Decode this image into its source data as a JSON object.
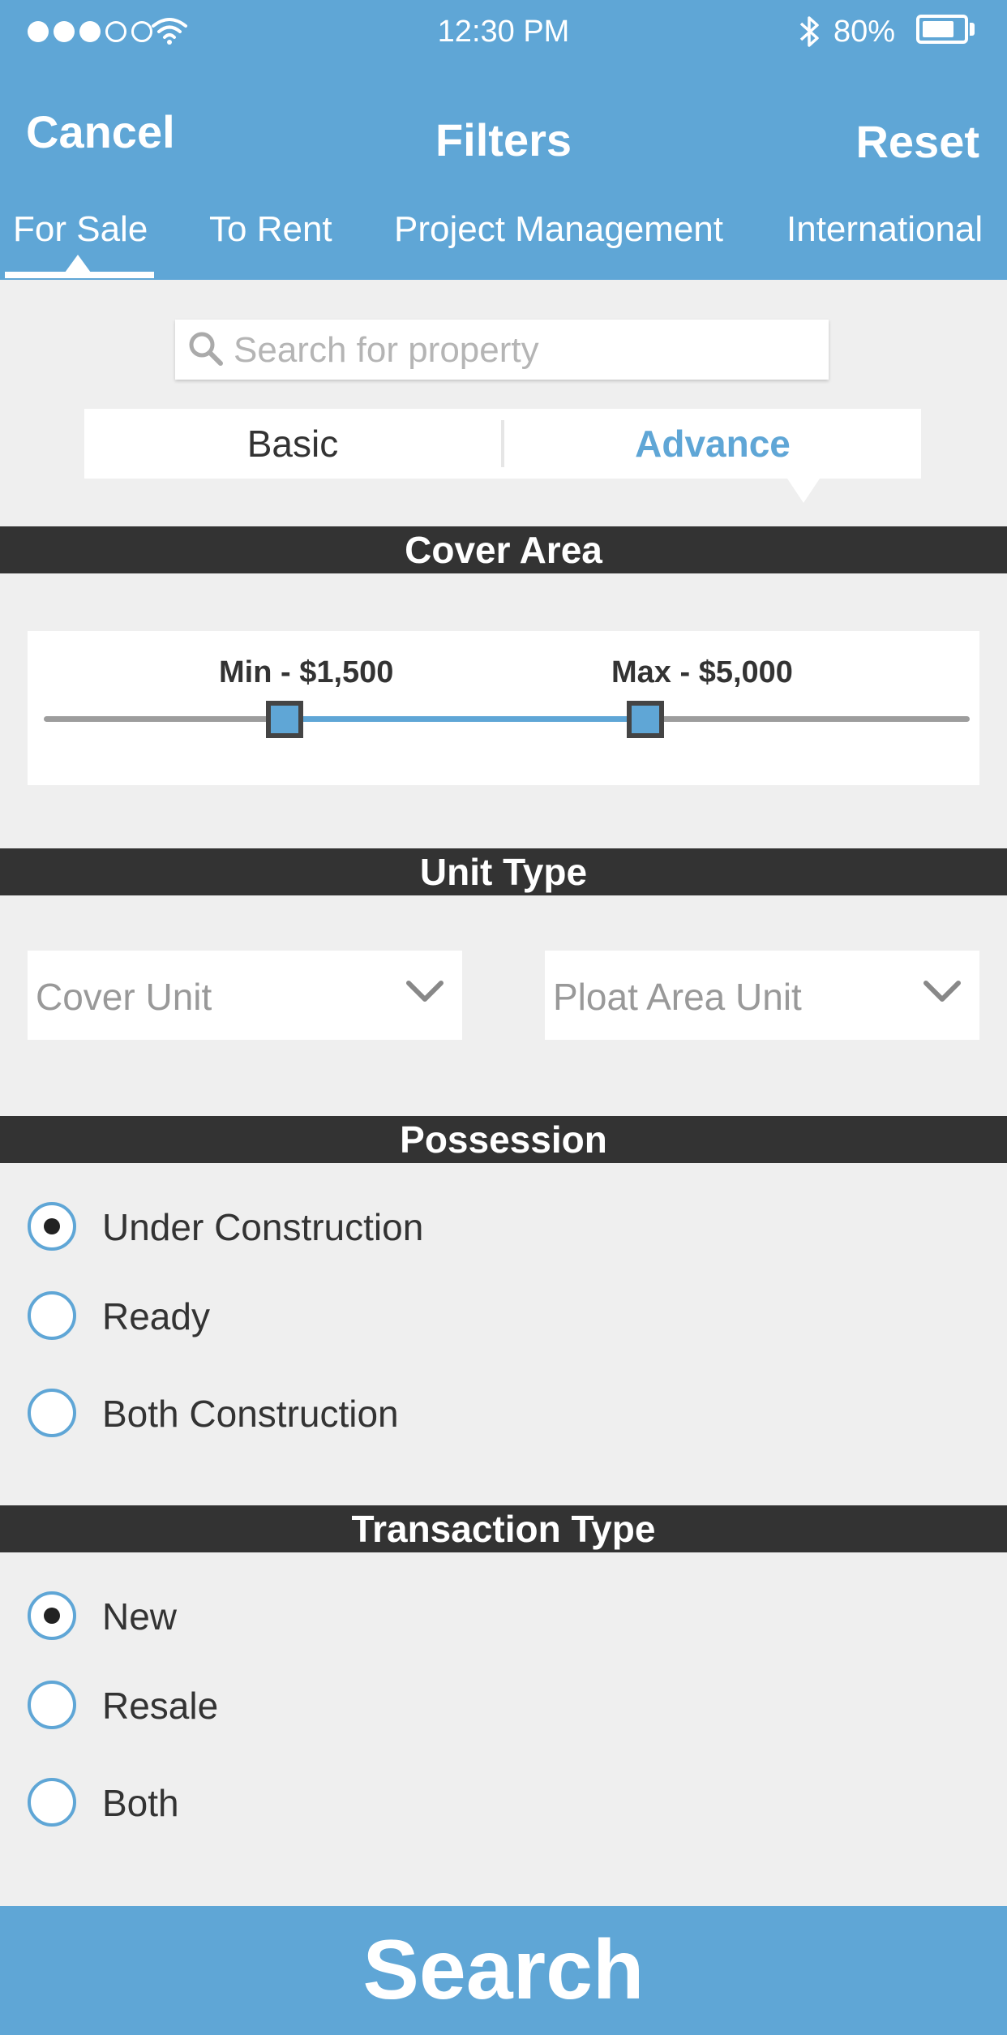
{
  "status_bar": {
    "time": "12:30 PM",
    "battery_percent": "80%",
    "battery_level": 0.8,
    "signal_bars_filled": 3,
    "signal_bars_total": 5,
    "icons": [
      "wifi-icon",
      "bluetooth-icon",
      "battery-icon"
    ]
  },
  "nav": {
    "cancel_label": "Cancel",
    "title": "Filters",
    "reset_label": "Reset"
  },
  "tabs": [
    {
      "label": "For Sale",
      "active": true
    },
    {
      "label": "To Rent",
      "active": false
    },
    {
      "label": "Project Management",
      "active": false
    },
    {
      "label": "International",
      "active": false
    }
  ],
  "search": {
    "placeholder": "Search for property",
    "value": ""
  },
  "mode": {
    "basic_label": "Basic",
    "advance_label": "Advance",
    "selected": "Advance"
  },
  "sections": {
    "cover_area": "Cover Area",
    "unit_type": "Unit Type",
    "possession": "Possession",
    "transaction_type": "Transaction Type"
  },
  "price_slider": {
    "min_label": "Min - $1,500",
    "max_label": "Max - $5,000",
    "min_position": 0.26,
    "max_position": 0.65
  },
  "unit_type": {
    "cover_unit": "Cover Unit",
    "ploat_area_unit": "Ploat Area Unit"
  },
  "possession": {
    "options": [
      "Under Construction",
      "Ready",
      "Both Construction"
    ],
    "selected": "Under Construction"
  },
  "transaction": {
    "options": [
      "New",
      "Resale",
      "Both"
    ],
    "selected": "New"
  },
  "search_button_label": "Search",
  "colors": {
    "accent": "#5fa6d6",
    "section_header": "#333333",
    "background": "#efefef"
  }
}
